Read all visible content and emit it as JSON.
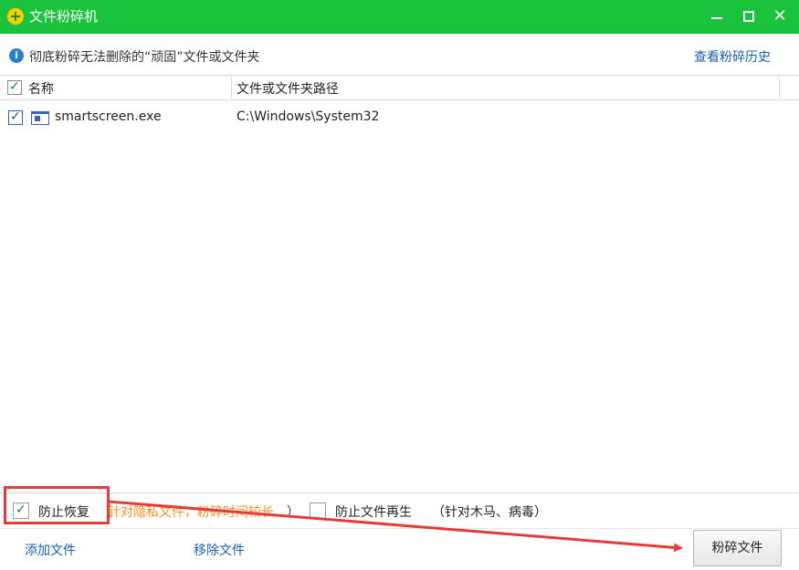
{
  "window": {
    "title": "文件粉碎机",
    "controls": [
      "minimize",
      "maximize",
      "close"
    ]
  },
  "infobar": {
    "text": "彻底粉碎无法删除的“顽固”文件或文件夹",
    "history_link": "查看粉碎历史"
  },
  "table": {
    "columns": [
      "名称",
      "文件或文件夹路径"
    ],
    "header_checked": true,
    "rows": [
      {
        "checked": true,
        "name": "smartscreen.exe",
        "path": "C:\\Windows\\System32"
      }
    ]
  },
  "options": {
    "prevent_recovery": {
      "checked": true,
      "label": "防止恢复",
      "paren_open": "（",
      "note": "针对隐私文件，粉碎时间较长",
      "paren_close": "）"
    },
    "prevent_regen": {
      "checked": false,
      "label": "防止文件再生",
      "note": "（针对木马、病毒）"
    }
  },
  "footer": {
    "add_file": "添加文件",
    "remove_file": "移除文件",
    "shred_button": "粉碎文件"
  },
  "colors": {
    "titlebar": "#19c33b",
    "link": "#1a5fb4",
    "note": "#ff8c1a",
    "annotation": "#e53b3b"
  }
}
